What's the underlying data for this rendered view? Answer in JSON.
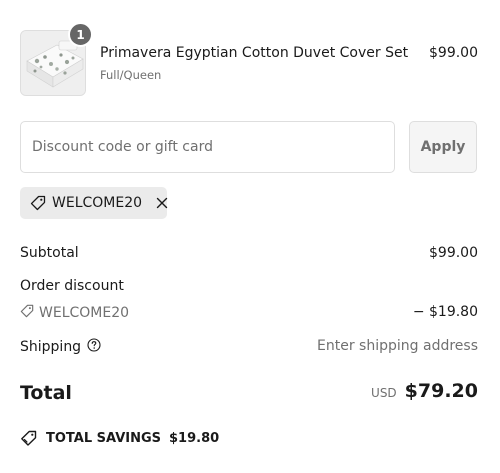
{
  "line_item": {
    "name": "Primavera Egyptian Cotton Duvet Cover Set",
    "variant": "Full/Queen",
    "price": "$99.00",
    "quantity": "1",
    "image_icon": "duvet-thumbnail-icon"
  },
  "discount": {
    "placeholder": "Discount code or gift card",
    "value": "",
    "apply_label": "Apply",
    "applied_code": "WELCOME20"
  },
  "summary": {
    "subtotal_label": "Subtotal",
    "subtotal_value": "$99.00",
    "order_discount_label": "Order discount",
    "discount_code": "WELCOME20",
    "discount_value": "− $19.80",
    "shipping_label": "Shipping",
    "shipping_value": "Enter shipping address"
  },
  "total": {
    "label": "Total",
    "currency": "USD",
    "amount": "$79.20"
  },
  "savings": {
    "label": "TOTAL SAVINGS",
    "amount": "$19.80"
  },
  "icons": {
    "tag": "tag-icon",
    "remove": "close-icon",
    "help": "question-circle-icon",
    "savings": "tag-outline-icon"
  },
  "colors": {
    "text": "#1a1a1a",
    "muted": "#707070",
    "border": "#dedede",
    "tag_bg": "#ebebeb",
    "badge_bg": "#666666"
  }
}
